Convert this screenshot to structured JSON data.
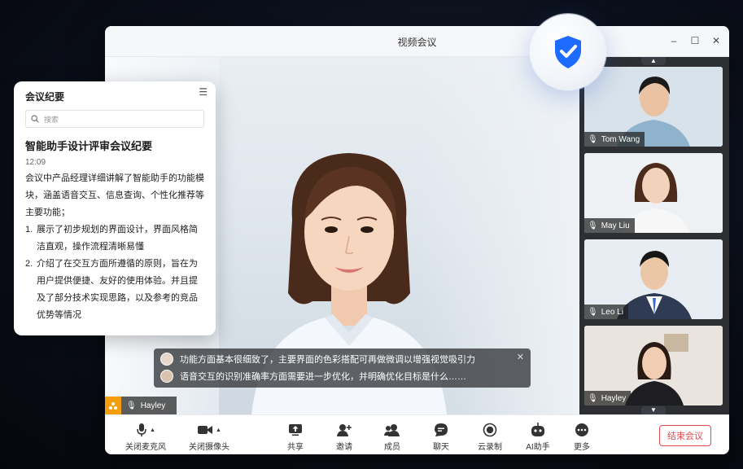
{
  "window": {
    "title": "视频会议"
  },
  "notes": {
    "header": "会议纪要",
    "search_placeholder": "搜索",
    "title": "智能助手设计评审会议纪要",
    "time": "12:09",
    "intro": "会议中产品经理详细讲解了智能助手的功能模块，涵盖语音交互、信息查询、个性化推荐等主要功能；",
    "points": [
      {
        "num": "1.",
        "text": "展示了初步规划的界面设计，界面风格简洁直观，操作流程清晰易懂"
      },
      {
        "num": "2.",
        "text": "介绍了在交互方面所遵循的原则，旨在为用户提供便捷、友好的使用体验。并且提及了部分技术实现思路，以及参考的竞品优势等情况"
      }
    ]
  },
  "main_speaker": {
    "name": "Hayley"
  },
  "participants": [
    {
      "name": "Tom Wang"
    },
    {
      "name": "May Liu"
    },
    {
      "name": "Leo Li"
    },
    {
      "name": "Hayley"
    }
  ],
  "subtitles": [
    {
      "text": "功能方面基本很细致了，主要界面的色彩搭配可再做微调以增强视觉吸引力"
    },
    {
      "text": "语音交互的识别准确率方面需要进一步优化，并明确优化目标是什么……"
    }
  ],
  "toolbar": {
    "mic": "关闭麦克风",
    "camera": "关闭摄像头",
    "share": "共享",
    "invite": "邀请",
    "members": "成员",
    "chat": "聊天",
    "record": "云录制",
    "ai": "AI助手",
    "more": "更多",
    "end": "结束会议"
  },
  "colors": {
    "accent": "#1e6bff",
    "danger": "#e5484d",
    "badge": "#f59e0b"
  }
}
